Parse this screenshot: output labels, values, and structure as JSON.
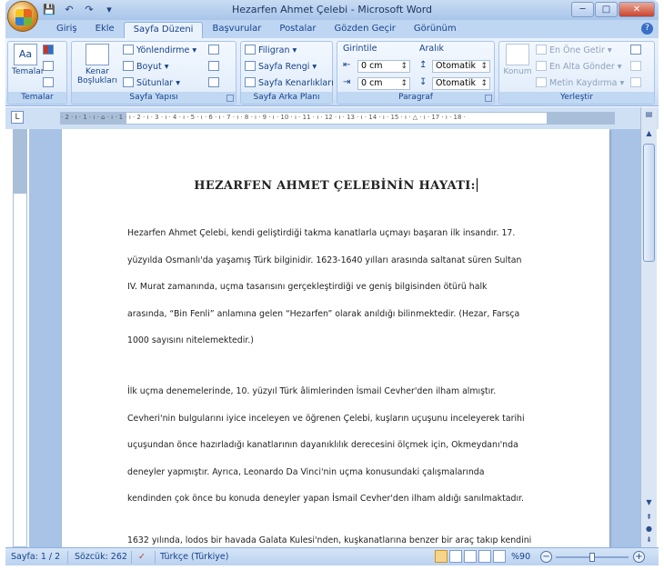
{
  "window": {
    "title": "Hezarfen Ahmet Çelebi - Microsoft Word",
    "minimize": "─",
    "maximize": "□",
    "close": "✕"
  },
  "qat": {
    "save": "💾",
    "undo": "↶",
    "redo": "↷",
    "more": "▾"
  },
  "tabs": [
    {
      "label": "Giriş"
    },
    {
      "label": "Ekle"
    },
    {
      "label": "Sayfa Düzeni"
    },
    {
      "label": "Başvurular"
    },
    {
      "label": "Postalar"
    },
    {
      "label": "Gözden Geçir"
    },
    {
      "label": "Görünüm"
    }
  ],
  "help": "?",
  "ribbon": {
    "temalar": {
      "big": "Temalar",
      "group": "Temalar"
    },
    "sayfa_yapisi": {
      "kenar": "Kenar Boşlukları",
      "yonlendirme": "Yönlendirme ▾",
      "boyut": "Boyut ▾",
      "sutunlar": "Sütunlar ▾",
      "group": "Sayfa Yapısı"
    },
    "arka_plan": {
      "filigran": "Filigran ▾",
      "sayfa_rengi": "Sayfa Rengi ▾",
      "kenarliklar": "Sayfa Kenarlıkları",
      "group": "Sayfa Arka Planı"
    },
    "paragraf": {
      "girinti": "Girintile",
      "aralik": "Aralık",
      "sol": "0 cm",
      "sag": "0 cm",
      "once": "Otomatik",
      "sonra": "Otomatik",
      "group": "Paragraf"
    },
    "yerlestir": {
      "konum": "Konum",
      "en_one": "En Öne Getir ▾",
      "en_alta": "En Alta Gönder ▾",
      "metin": "Metin Kaydırma ▾",
      "group": "Yerleştir"
    }
  },
  "ruler": {
    "ticks": "· 2 · ı · 1 · ı · ⌂ · ı · 1 · ı · 2 · ı · 3 · ı · 4 · ı · 5 · ı · 6 · ı · 7 · ı · 8 · ı · 9 · ı · 10 · ı · 11 · ı · 12 · ı · 13 · ı · 14 · ı · 15 · ı · △ · ı · 17 · ı · 18 ·",
    "corner": "L"
  },
  "document": {
    "title": "HEZARFEN AHMET ÇELEBİNİN HAYATI:",
    "para1": [
      "Hezarfen Ahmet Çelebi, kendi geliştirdiği takma kanatlarla uçmayı başaran ilk insandır. 17.",
      "yüzyılda Osmanlı'da yaşamış Türk bilginidir. 1623-1640 yılları arasında saltanat süren Sultan",
      "IV. Murat zamanında, uçma tasarısını gerçekleştirdiği ve geniş bilgisinden ötürü halk",
      "arasında, “Bin Fenli” anlamına gelen “Hezarfen” olarak anıldığı bilinmektedir. (Hezar, Farsça",
      "1000 sayısını nitelemektedir.)"
    ],
    "para2": [
      "İlk uçma denemelerinde, 10. yüzyıl Türk âlimlerinden İsmail Cevher'den ilham almıştır.",
      "Cevheri'nin bulgularını iyice inceleyen ve öğrenen Çelebi, kuşların uçuşunu inceleyerek tarihi",
      "uçuşundan önce hazırladığı kanatlarının dayanıklılık derecesini ölçmek için, Okmeydanı'nda",
      "deneyler yapmıştır. Ayrıca, Leonardo Da Vinci'nin uçma konusundaki çalışmalarında",
      "kendinden çok önce bu konuda deneyler yapan İsmail Cevher'den ilham aldığı sanılmaktadır."
    ],
    "para3": [
      "1632 yılında, lodos bir havada Galata Kulesi'nden, kuşkanatlarına benzer bir araç takıp kendini"
    ]
  },
  "status": {
    "page": "Sayfa: 1 / 2",
    "words": "Sözcük: 262",
    "language": "Türkçe (Türkiye)",
    "zoom": "%90",
    "zoom_out": "−",
    "zoom_in": "+"
  },
  "scroll": {
    "up": "▲",
    "down": "▼",
    "prev": "●",
    "next": "⬍"
  }
}
